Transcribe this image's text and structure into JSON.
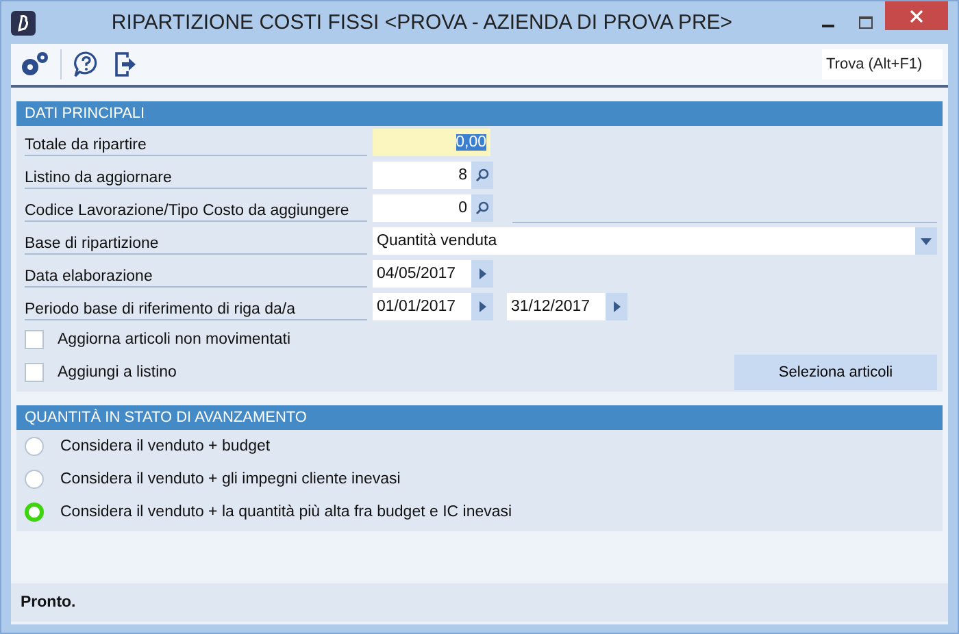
{
  "window": {
    "title": "RIPARTIZIONE COSTI FISSI <PROVA - AZIENDA DI PROVA PRE>"
  },
  "toolbar": {
    "search_placeholder": "Trova (Alt+F1)"
  },
  "main_section": {
    "title": "DATI PRINCIPALI",
    "fields": [
      {
        "label": "Totale da ripartire",
        "kind": "number",
        "value": "0,00",
        "focused": true
      },
      {
        "label": "Listino da aggiornare",
        "kind": "lookup",
        "value": "8"
      },
      {
        "label": "Codice Lavorazione/Tipo Costo da aggiungere",
        "kind": "lookup",
        "value": "0"
      },
      {
        "label": "Base di ripartizione",
        "kind": "dropdown",
        "value": "Quantità venduta"
      },
      {
        "label": "Data elaborazione",
        "kind": "date",
        "value": "04/05/2017"
      },
      {
        "label": "Periodo base di riferimento di riga da/a",
        "kind": "date-range",
        "value": "01/01/2017",
        "value_to": "31/12/2017"
      }
    ],
    "checkboxes": [
      {
        "label": "Aggiorna articoli non movimentati",
        "checked": false
      },
      {
        "label": "Aggiungi a listino",
        "checked": false
      }
    ],
    "button": "Seleziona articoli"
  },
  "progress_section": {
    "title": "QUANTITÀ IN STATO DI AVANZAMENTO",
    "options": [
      {
        "label": "Considera il venduto + budget",
        "selected": false
      },
      {
        "label": "Considera il venduto + gli impegni cliente inevasi",
        "selected": false
      },
      {
        "label": "Considera il venduto + la quantità più alta fra budget e IC inevasi",
        "selected": true
      }
    ]
  },
  "status_bar": {
    "text": "Pronto."
  }
}
